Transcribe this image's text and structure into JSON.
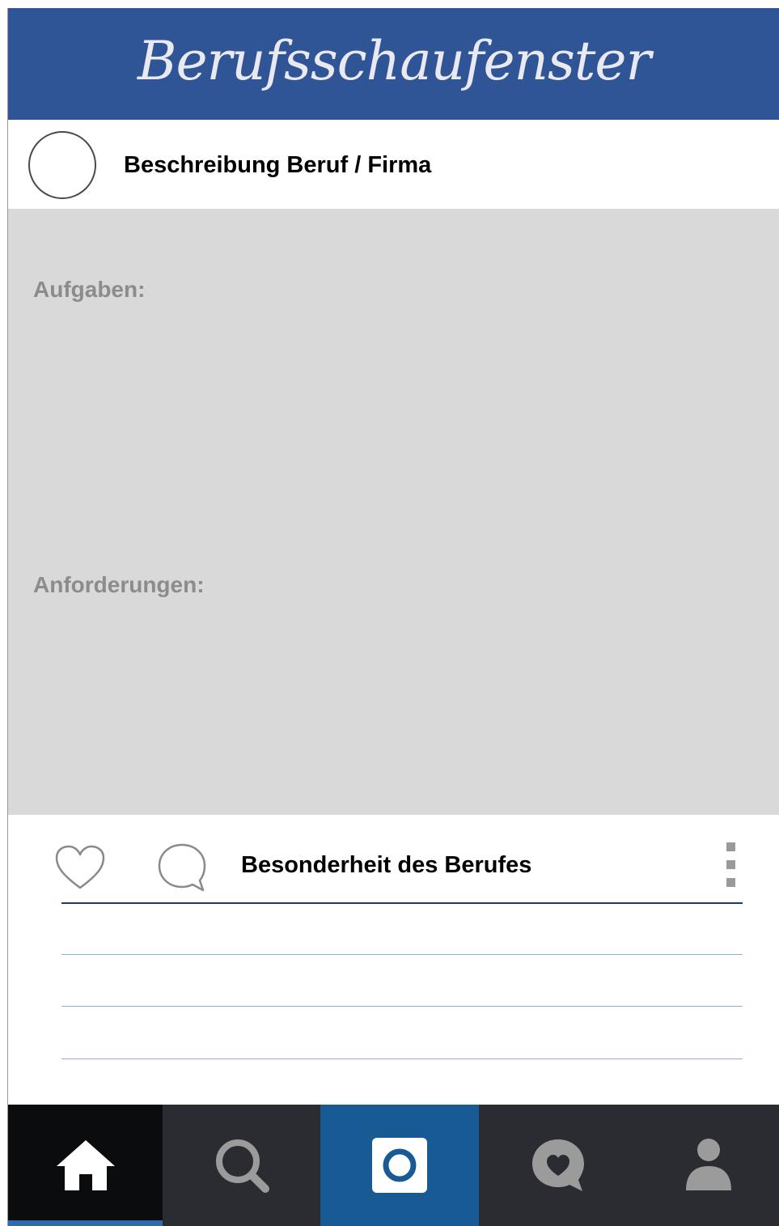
{
  "header": {
    "title": "Berufsschaufenster"
  },
  "profile": {
    "title": "Beschreibung Beruf / Firma"
  },
  "panel": {
    "tasks_label": "Aufgaben:",
    "requirements_label": "Anforderungen:"
  },
  "actions": {
    "caption": "Besonderheit des Berufes"
  },
  "tabs": [
    {
      "icon": "home-icon",
      "active": true
    },
    {
      "icon": "search-icon"
    },
    {
      "icon": "camera-icon"
    },
    {
      "icon": "chat-heart-icon"
    },
    {
      "icon": "person-icon"
    }
  ],
  "colors": {
    "brand": "#2f5597",
    "tab_active": "#185b94",
    "tab_bg": "#2a2c31"
  }
}
